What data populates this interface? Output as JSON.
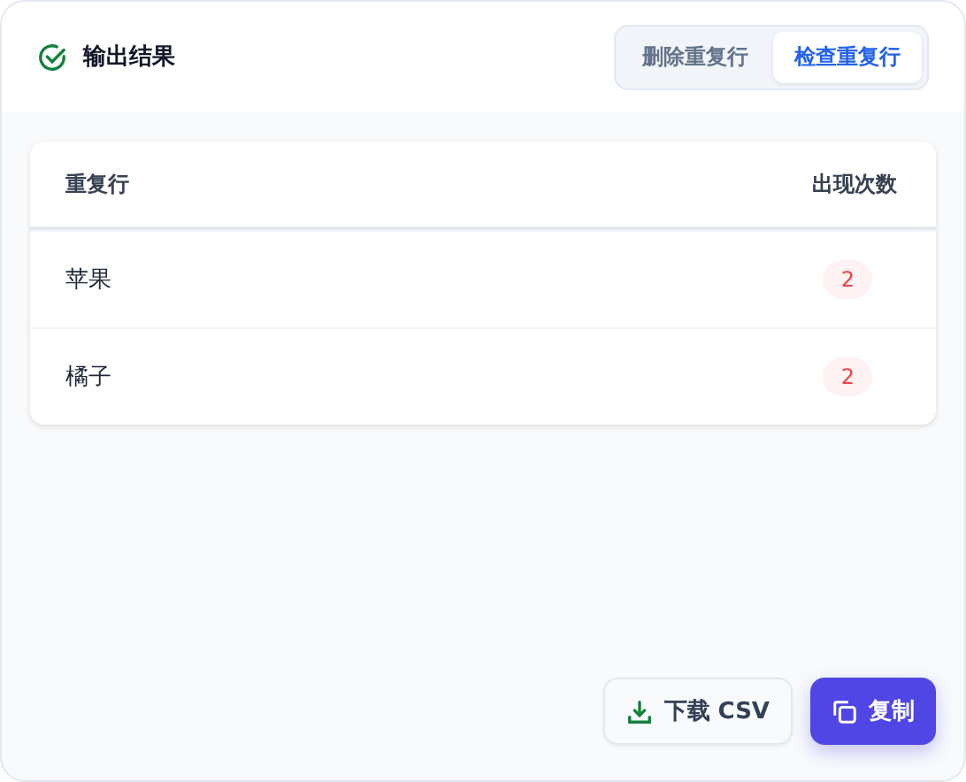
{
  "header": {
    "title": "输出结果",
    "tabs": [
      {
        "label": "删除重复行",
        "selected": false
      },
      {
        "label": "检查重复行",
        "selected": true
      }
    ]
  },
  "table": {
    "columns": [
      "重复行",
      "出现次数"
    ],
    "rows": [
      {
        "line": "苹果",
        "count": "2"
      },
      {
        "line": "橘子",
        "count": "2"
      }
    ]
  },
  "buttons": [
    {
      "kind": "download",
      "label": "下载 CSV"
    },
    {
      "kind": "copy",
      "label": "复制"
    }
  ]
}
